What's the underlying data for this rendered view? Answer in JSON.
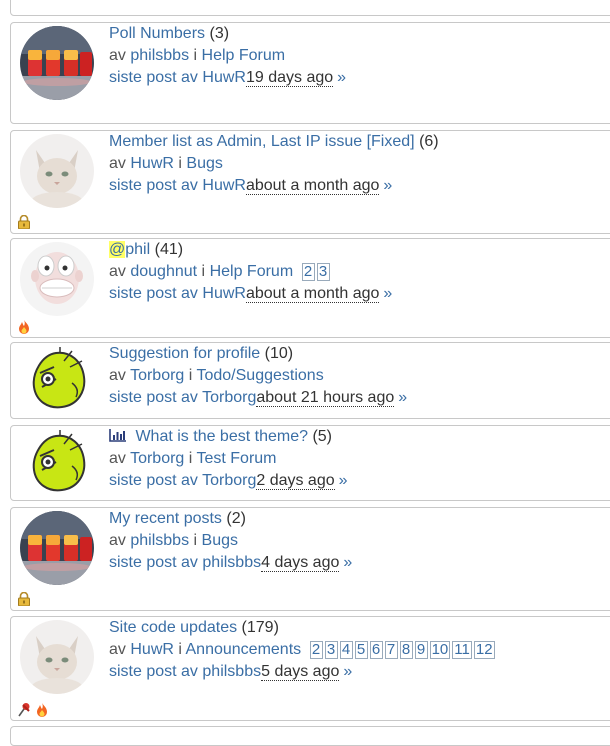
{
  "topics": [
    {
      "title": "Poll Numbers",
      "count": "(3)",
      "highlight": "",
      "by_word": "av",
      "author": "philsbbs",
      "in_word": "i",
      "forum": "Help Forum",
      "last_prefix": "siste post av",
      "last_author": "HuwR",
      "time": "19 days ago",
      "raquo": "»",
      "pages": [],
      "avatar": "drinks",
      "status": [],
      "poll": false
    },
    {
      "title": "Member list as Admin, Last IP issue [Fixed]",
      "count": "(6)",
      "highlight": "",
      "by_word": "av",
      "author": "HuwR",
      "in_word": "i",
      "forum": "Bugs",
      "last_prefix": "siste post av",
      "last_author": "HuwR",
      "time": "about a month ago",
      "raquo": "»",
      "pages": [],
      "avatar": "cat",
      "status": [
        "lock-icon"
      ],
      "poll": false
    },
    {
      "title": "phil",
      "count": "(41)",
      "highlight": "@",
      "by_word": "av",
      "author": "doughnut",
      "in_word": "i",
      "forum": "Help Forum",
      "last_prefix": "siste post av",
      "last_author": "HuwR",
      "time": "about a month ago",
      "raquo": "»",
      "pages": [
        "2",
        "3"
      ],
      "avatar": "clay",
      "status": [
        "fire-icon"
      ],
      "poll": false
    },
    {
      "title": "Suggestion for profile",
      "count": "(10)",
      "highlight": "",
      "by_word": "av",
      "author": "Torborg",
      "in_word": "i",
      "forum": "Todo/Suggestions",
      "last_prefix": "siste post av",
      "last_author": "Torborg",
      "time": "about 21 hours ago",
      "raquo": "»",
      "pages": [],
      "avatar": "green",
      "status": [],
      "poll": false
    },
    {
      "title": "What is the best theme?",
      "count": "(5)",
      "highlight": "",
      "by_word": "av",
      "author": "Torborg",
      "in_word": "i",
      "forum": "Test Forum",
      "last_prefix": "siste post av",
      "last_author": "Torborg",
      "time": "2 days ago",
      "raquo": "»",
      "pages": [],
      "avatar": "green",
      "status": [],
      "poll": true
    },
    {
      "title": "My recent posts",
      "count": "(2)",
      "highlight": "",
      "by_word": "av",
      "author": "philsbbs",
      "in_word": "i",
      "forum": "Bugs",
      "last_prefix": "siste post av",
      "last_author": "philsbbs",
      "time": "4 days ago",
      "raquo": "»",
      "pages": [],
      "avatar": "drinks",
      "status": [
        "lock-icon"
      ],
      "poll": false
    },
    {
      "title": "Site code updates",
      "count": "(179)",
      "highlight": "",
      "by_word": "av",
      "author": "HuwR",
      "in_word": "i",
      "forum": "Announcements",
      "last_prefix": "siste post av",
      "last_author": "philsbbs",
      "time": "5 days ago",
      "raquo": "»",
      "pages": [
        "2",
        "3",
        "4",
        "5",
        "6",
        "7",
        "8",
        "9",
        "10",
        "11",
        "12"
      ],
      "avatar": "cat",
      "status": [
        "pin-icon",
        "fire-icon"
      ],
      "poll": false
    }
  ],
  "colors": {
    "link": "#3a6ea5",
    "border": "#c8c8c8",
    "highlight": "#ffff66"
  }
}
